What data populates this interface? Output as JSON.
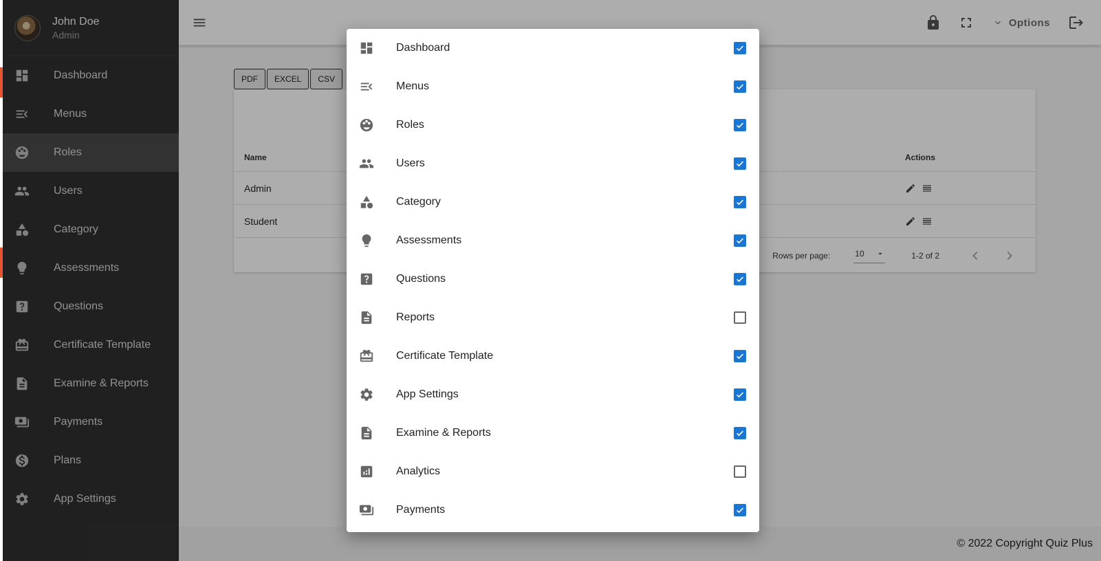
{
  "profile": {
    "name": "John Doe",
    "role": "Admin"
  },
  "sidebar": {
    "items": [
      {
        "label": "Dashboard",
        "icon": "dashboard-icon"
      },
      {
        "label": "Menus",
        "icon": "menu-open-icon"
      },
      {
        "label": "Roles",
        "icon": "roles-icon"
      },
      {
        "label": "Users",
        "icon": "users-icon"
      },
      {
        "label": "Category",
        "icon": "category-icon"
      },
      {
        "label": "Assessments",
        "icon": "lightbulb-icon"
      },
      {
        "label": "Questions",
        "icon": "question-icon"
      },
      {
        "label": "Certificate Template",
        "icon": "certificate-icon"
      },
      {
        "label": "Examine & Reports",
        "icon": "document-icon"
      },
      {
        "label": "Payments",
        "icon": "payments-icon"
      },
      {
        "label": "Plans",
        "icon": "dollar-icon"
      },
      {
        "label": "App Settings",
        "icon": "gear-icon"
      }
    ],
    "active": "Roles"
  },
  "topbar": {
    "options_label": "Options"
  },
  "export": {
    "pdf": "PDF",
    "excel": "EXCEL",
    "csv": "CSV"
  },
  "table": {
    "columns": {
      "name": "Name",
      "actions": "Actions"
    },
    "rows": [
      {
        "name": "Admin"
      },
      {
        "name": "Student"
      }
    ],
    "pagination": {
      "rows_per_page_label": "Rows per page:",
      "rows_per_page": "10",
      "range": "1-2 of 2"
    }
  },
  "footer": {
    "text": "© 2022 Copyright Quiz Plus"
  },
  "dialog": {
    "options": [
      {
        "label": "Dashboard",
        "icon": "dashboard-icon",
        "checked": true
      },
      {
        "label": "Menus",
        "icon": "menu-open-icon",
        "checked": true
      },
      {
        "label": "Roles",
        "icon": "roles-icon",
        "checked": true
      },
      {
        "label": "Users",
        "icon": "users-icon",
        "checked": true
      },
      {
        "label": "Category",
        "icon": "category-icon",
        "checked": true
      },
      {
        "label": "Assessments",
        "icon": "lightbulb-icon",
        "checked": true
      },
      {
        "label": "Questions",
        "icon": "question-icon",
        "checked": true
      },
      {
        "label": "Reports",
        "icon": "document-icon",
        "checked": false
      },
      {
        "label": "Certificate Template",
        "icon": "certificate-icon",
        "checked": true
      },
      {
        "label": "App Settings",
        "icon": "gear-icon",
        "checked": true
      },
      {
        "label": "Examine & Reports",
        "icon": "document-icon",
        "checked": true
      },
      {
        "label": "Analytics",
        "icon": "analytics-icon",
        "checked": false
      },
      {
        "label": "Payments",
        "icon": "payments-icon",
        "checked": true
      }
    ]
  },
  "colors": {
    "sidebar_bg": "#303030",
    "accent": "#1976d2",
    "brand_mark": "#e4572e"
  }
}
